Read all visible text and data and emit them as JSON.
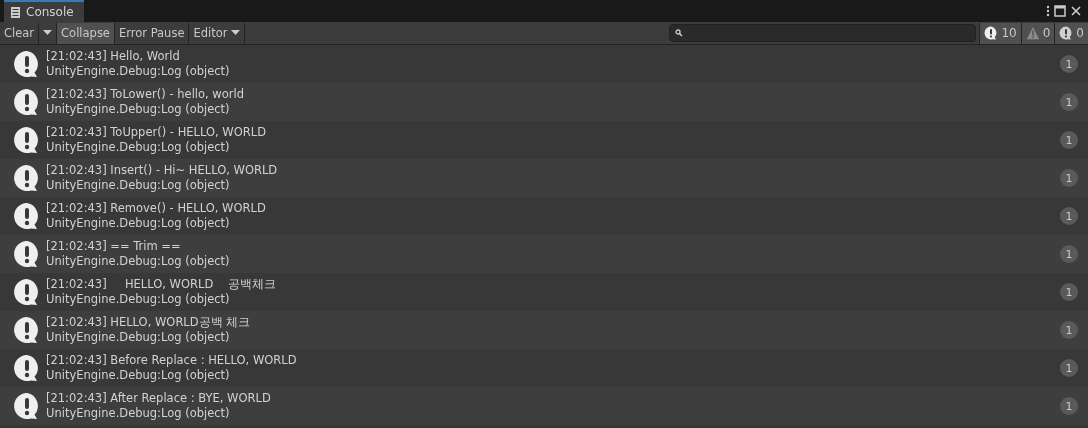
{
  "window": {
    "tab": "Console"
  },
  "toolbar": {
    "buttons": [
      {
        "kind": "dropdown-split",
        "label": "Clear",
        "selected": false
      },
      {
        "kind": "toggle",
        "label": "Collapse",
        "selected": true
      },
      {
        "kind": "toggle",
        "label": "Error Pause",
        "selected": false
      },
      {
        "kind": "dropdown",
        "label": "Editor",
        "selected": false
      }
    ],
    "counts": [
      {
        "kind": "info",
        "label": "10"
      },
      {
        "kind": "warning",
        "label": "0"
      },
      {
        "kind": "error",
        "label": "0"
      }
    ]
  },
  "entries": [
    {
      "message": "[21:02:43] Hello, World",
      "trace": "UnityEngine.Debug:Log (object)",
      "count": "1"
    },
    {
      "message": "[21:02:43] ToLower() - hello, world",
      "trace": "UnityEngine.Debug:Log (object)",
      "count": "1"
    },
    {
      "message": "[21:02:43] ToUpper() - HELLO, WORLD",
      "trace": "UnityEngine.Debug:Log (object)",
      "count": "1"
    },
    {
      "message": "[21:02:43] Insert() - Hi~ HELLO, WORLD",
      "trace": "UnityEngine.Debug:Log (object)",
      "count": "1"
    },
    {
      "message": "[21:02:43] Remove() - HELLO, WORLD",
      "trace": "UnityEngine.Debug:Log (object)",
      "count": "1"
    },
    {
      "message": "[21:02:43] == Trim ==",
      "trace": "UnityEngine.Debug:Log (object)",
      "count": "1"
    },
    {
      "message": "[21:02:43]     HELLO, WORLD    공백체크",
      "trace": "UnityEngine.Debug:Log (object)",
      "count": "1"
    },
    {
      "message": "[21:02:43] HELLO, WORLD공백 체크",
      "trace": "UnityEngine.Debug:Log (object)",
      "count": "1"
    },
    {
      "message": "[21:02:43] Before Replace : HELLO, WORLD",
      "trace": "UnityEngine.Debug:Log (object)",
      "count": "1"
    },
    {
      "message": "[21:02:43] After Replace : BYE, WORLD",
      "trace": "UnityEngine.Debug:Log (object)",
      "count": "1"
    }
  ]
}
